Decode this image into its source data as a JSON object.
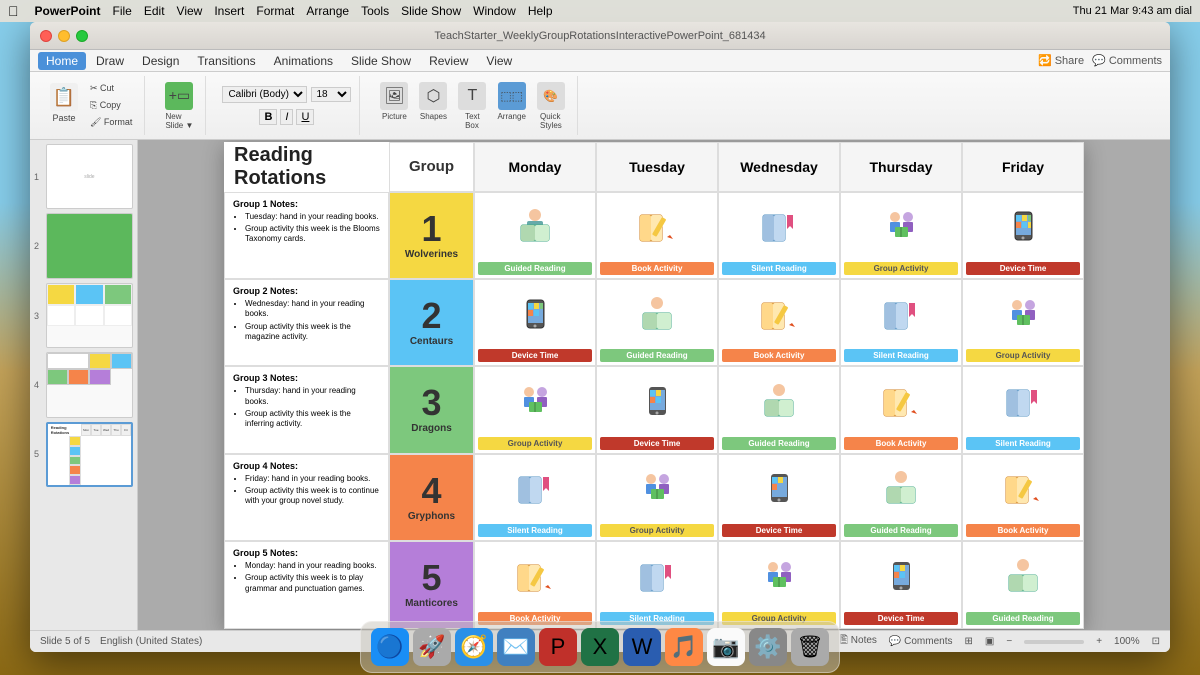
{
  "desktop": {
    "menubar": {
      "apple": "⌘",
      "items": [
        "PowerPoint",
        "File",
        "Edit",
        "View",
        "Insert",
        "Format",
        "Arrange",
        "Tools",
        "Slide Show",
        "Window",
        "Help"
      ],
      "right": "Thu 21 Mar  9:43 am  dial"
    }
  },
  "window": {
    "title": "TeachStarter_WeeklyGroupRotationsInteractivePowerPoint_681434",
    "tabs": [
      "Home",
      "Draw",
      "Design",
      "Transitions",
      "Animations",
      "Slide Show",
      "Review",
      "View"
    ],
    "active_tab": "Home"
  },
  "slide": {
    "title": "Reading Rotations",
    "columns": [
      "Group",
      "Monday",
      "Tuesday",
      "Wednesday",
      "Thursday",
      "Friday"
    ],
    "groups": [
      {
        "number": "1",
        "name": "Wolverines",
        "color": "g1",
        "notes_title": "Group 1 Notes:",
        "notes": [
          "Tuesday: hand in your reading books.",
          "Group activity this week is the Blooms Taxonomy cards."
        ],
        "activities": [
          "Guided Reading",
          "Book Activity",
          "Silent Reading",
          "Group Activity",
          "Device Time"
        ],
        "icons": [
          "👦📖",
          "📝",
          "📖",
          "👥",
          "📱"
        ]
      },
      {
        "number": "2",
        "name": "Centaurs",
        "color": "g2",
        "notes_title": "Group 2 Notes:",
        "notes": [
          "Wednesday: hand in your reading books.",
          "Group activity this week is the magazine activity."
        ],
        "activities": [
          "Device Time",
          "Guided Reading",
          "Book Activity",
          "Silent Reading",
          "Group Activity"
        ],
        "icons": [
          "📱",
          "👦📖",
          "📝",
          "📖",
          "👥"
        ]
      },
      {
        "number": "3",
        "name": "Dragons",
        "color": "g3",
        "notes_title": "Group 3 Notes:",
        "notes": [
          "Thursday: hand in your reading books.",
          "Group activity this week is the inferring activity."
        ],
        "activities": [
          "Group Activity",
          "Device Time",
          "Guided Reading",
          "Book Activity",
          "Silent Reading"
        ],
        "icons": [
          "👥",
          "📱",
          "👦📖",
          "📝",
          "📖"
        ]
      },
      {
        "number": "4",
        "name": "Gryphons",
        "color": "g4",
        "notes_title": "Group 4 Notes:",
        "notes": [
          "Friday: hand in your reading books.",
          "Group activity this week is to continue with your group novel study."
        ],
        "activities": [
          "Silent Reading",
          "Group Activity",
          "Device Time",
          "Guided Reading",
          "Book Activity"
        ],
        "icons": [
          "📖",
          "👥",
          "📱",
          "👦📖",
          "📝"
        ]
      },
      {
        "number": "5",
        "name": "Manticores",
        "color": "g5",
        "notes_title": "Group 5 Notes:",
        "notes": [
          "Monday: hand in your reading books.",
          "Group activity this week is to play grammar and punctuation games."
        ],
        "activities": [
          "Book Activity",
          "Silent Reading",
          "Group Activity",
          "Device Time",
          "Guided Reading"
        ],
        "icons": [
          "📝",
          "📖",
          "👥",
          "📱",
          "👦📖"
        ]
      }
    ]
  },
  "statusbar": {
    "slide_info": "Slide 5 of 5",
    "language": "English (United States)",
    "zoom": "100%"
  }
}
